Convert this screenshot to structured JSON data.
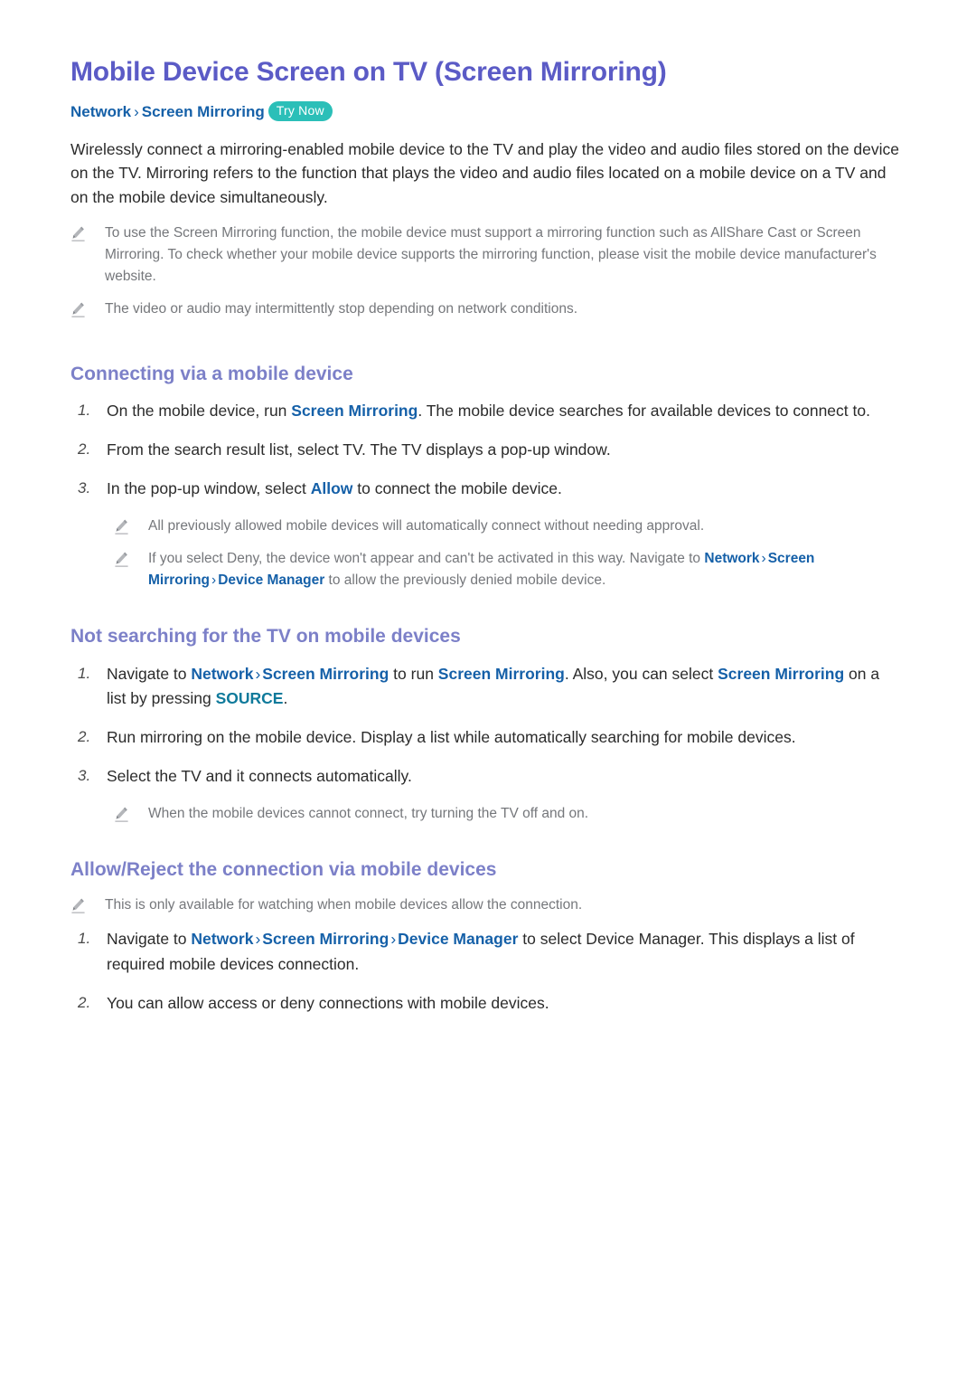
{
  "page": {
    "title": "Mobile Device Screen on TV (Screen Mirroring)",
    "colors": {
      "title": "#5b5bc6",
      "section_heading": "#7c80c8",
      "keyword_blue": "#1560a8",
      "keyword_teal": "#0f7a9b",
      "badge_teal": "#2bbfb8",
      "body_text": "#2b2b2b",
      "note_text": "#75777b"
    }
  },
  "breadcrumb": {
    "item1": "Network",
    "separator": "›",
    "item2": "Screen Mirroring",
    "badge": "Try Now"
  },
  "intro": {
    "paragraph": "Wirelessly connect a mirroring-enabled mobile device to the TV and play the video and audio files stored on the device on the TV. Mirroring refers to the function that plays the video and audio files located on a mobile device on a TV and on the mobile device simultaneously."
  },
  "intro_notes": [
    {
      "icon": "pencil-icon",
      "text": "To use the Screen Mirroring function, the mobile device must support a mirroring function such as AllShare Cast or Screen Mirroring. To check whether your mobile device supports the mirroring function, please visit the mobile device manufacturer's website."
    },
    {
      "icon": "pencil-icon",
      "text": "The video or audio may intermittently stop depending on network conditions."
    }
  ],
  "sections": [
    {
      "heading": "Connecting via a mobile device",
      "steps": [
        {
          "num": "1.",
          "parts": [
            {
              "type": "text",
              "value": "On the mobile device, run "
            },
            {
              "type": "kw",
              "value": "Screen Mirroring"
            },
            {
              "type": "text",
              "value": ". The mobile device searches for available devices to connect to."
            }
          ]
        },
        {
          "num": "2.",
          "parts": [
            {
              "type": "text",
              "value": "From the search result list, select TV. The TV displays a pop-up window."
            }
          ]
        },
        {
          "num": "3.",
          "parts": [
            {
              "type": "text",
              "value": "In the pop-up window, select "
            },
            {
              "type": "kw",
              "value": "Allow"
            },
            {
              "type": "text",
              "value": " to connect the mobile device."
            }
          ]
        }
      ],
      "notes": [
        {
          "icon": "pencil-icon",
          "parts": [
            {
              "type": "text",
              "value": "All previously allowed mobile devices will automatically connect without needing approval."
            }
          ]
        },
        {
          "icon": "pencil-icon",
          "parts": [
            {
              "type": "text",
              "value": "If you select Deny, the device won't appear and can't be activated in this way. Navigate to "
            },
            {
              "type": "kw",
              "value": "Network"
            },
            {
              "type": "sep",
              "value": "›"
            },
            {
              "type": "kw",
              "value": "Screen Mirroring"
            },
            {
              "type": "sep",
              "value": "›"
            },
            {
              "type": "kw",
              "value": "Device Manager"
            },
            {
              "type": "text",
              "value": " to allow the previously denied mobile device."
            }
          ]
        }
      ]
    },
    {
      "heading": "Not searching for the TV on mobile devices",
      "steps": [
        {
          "num": "1.",
          "parts": [
            {
              "type": "text",
              "value": "Navigate to "
            },
            {
              "type": "kw",
              "value": "Network"
            },
            {
              "type": "sep",
              "value": "›"
            },
            {
              "type": "kw",
              "value": "Screen Mirroring"
            },
            {
              "type": "text",
              "value": " to run "
            },
            {
              "type": "kw",
              "value": "Screen Mirroring"
            },
            {
              "type": "text",
              "value": ". Also, you can select "
            },
            {
              "type": "kw",
              "value": "Screen Mirroring"
            },
            {
              "type": "text",
              "value": " on a list by pressing "
            },
            {
              "type": "kwsrc",
              "value": "SOURCE"
            },
            {
              "type": "text",
              "value": "."
            }
          ]
        },
        {
          "num": "2.",
          "parts": [
            {
              "type": "text",
              "value": "Run mirroring on the mobile device. Display a list while automatically searching for mobile devices."
            }
          ]
        },
        {
          "num": "3.",
          "parts": [
            {
              "type": "text",
              "value": "Select the TV and it connects automatically."
            }
          ]
        }
      ],
      "notes": [
        {
          "icon": "pencil-icon",
          "parts": [
            {
              "type": "text",
              "value": "When the mobile devices cannot connect, try turning the TV off and on."
            }
          ]
        }
      ]
    },
    {
      "heading": "Allow/Reject the connection via mobile devices",
      "lead_notes": [
        {
          "icon": "pencil-icon",
          "parts": [
            {
              "type": "text",
              "value": "This is only available for watching when mobile devices allow the connection."
            }
          ]
        }
      ],
      "steps": [
        {
          "num": "1.",
          "parts": [
            {
              "type": "text",
              "value": "Navigate to "
            },
            {
              "type": "kw",
              "value": "Network"
            },
            {
              "type": "sep",
              "value": "›"
            },
            {
              "type": "kw",
              "value": "Screen Mirroring"
            },
            {
              "type": "sep",
              "value": "›"
            },
            {
              "type": "kw",
              "value": "Device Manager"
            },
            {
              "type": "text",
              "value": " to select Device Manager. This displays a list of required mobile devices connection."
            }
          ]
        },
        {
          "num": "2.",
          "parts": [
            {
              "type": "text",
              "value": "You can allow access or deny connections with mobile devices."
            }
          ]
        }
      ]
    }
  ]
}
